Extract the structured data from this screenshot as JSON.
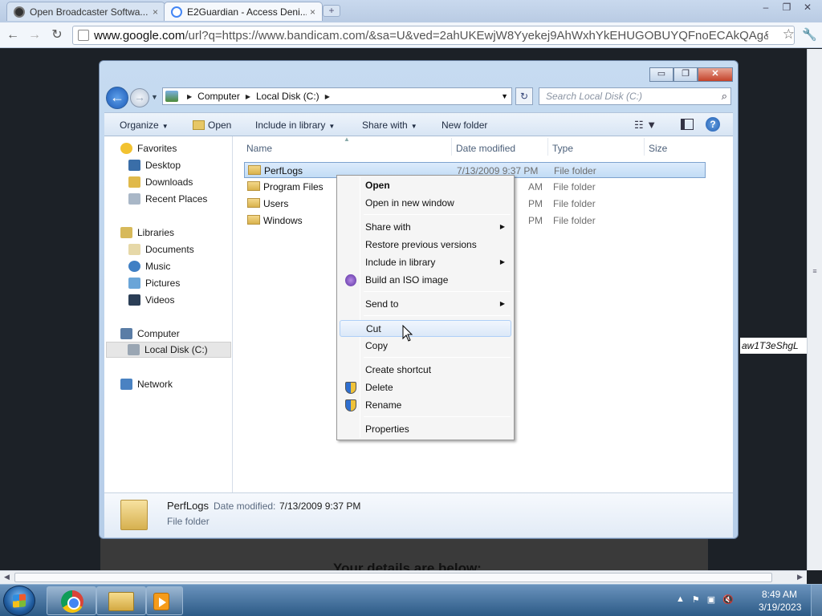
{
  "browser": {
    "tabs": [
      {
        "title": "Open Broadcaster Softwa...",
        "close": "×"
      },
      {
        "title": "E2Guardian - Access Deni...",
        "close": "×"
      }
    ],
    "new_tab": "+",
    "window_buttons": [
      "–",
      "❐",
      "✕"
    ],
    "nav": {
      "back": "←",
      "forward": "→",
      "reload": "↻"
    },
    "url_domain": "www.google.com",
    "url_rest": "/url?q=https://www.bandicam.com/&sa=U&ved=2ahUKEwjW8Yyekej9AhWxhYkEHUGOBUYQFnoECAkQAg&us",
    "star": "☆",
    "menu": "🔧"
  },
  "page": {
    "bottom_text": "Your details are below:",
    "side_text": "aw1T3eShgL"
  },
  "explorer": {
    "window_buttons": [
      "▭",
      "❐",
      "✕"
    ],
    "breadcrumbs": [
      "Computer",
      "Local Disk (C:)"
    ],
    "search_placeholder": "Search Local Disk (C:)",
    "commands": {
      "organize": "Organize",
      "open": "Open",
      "include": "Include in library",
      "share": "Share with",
      "new_folder": "New folder"
    },
    "nav": {
      "favorites": "Favorites",
      "desktop": "Desktop",
      "downloads": "Downloads",
      "recent": "Recent Places",
      "libraries": "Libraries",
      "documents": "Documents",
      "music": "Music",
      "pictures": "Pictures",
      "videos": "Videos",
      "computer": "Computer",
      "local_disk": "Local Disk (C:)",
      "network": "Network"
    },
    "columns": {
      "name": "Name",
      "date": "Date modified",
      "type": "Type",
      "size": "Size"
    },
    "files": [
      {
        "name": "PerfLogs",
        "date": "7/13/2009 9:37 PM",
        "type": "File folder"
      },
      {
        "name": "Program Files",
        "date": "AM",
        "type": "File folder"
      },
      {
        "name": "Users",
        "date": "PM",
        "type": "File folder"
      },
      {
        "name": "Windows",
        "date": "PM",
        "type": "File folder"
      }
    ],
    "details": {
      "name": "PerfLogs",
      "date_label": "Date modified:",
      "date": "7/13/2009 9:37 PM",
      "type": "File folder"
    }
  },
  "context_menu": {
    "open": "Open",
    "open_new": "Open in new window",
    "share": "Share with",
    "restore": "Restore previous versions",
    "include": "Include in library",
    "iso": "Build an ISO image",
    "send_to": "Send to",
    "cut": "Cut",
    "copy": "Copy",
    "shortcut": "Create shortcut",
    "delete": "Delete",
    "rename": "Rename",
    "properties": "Properties"
  },
  "taskbar": {
    "tray_icons": [
      "▲",
      "⚑",
      "▣",
      "🔇"
    ],
    "time": "8:49 AM",
    "date": "3/19/2023"
  }
}
